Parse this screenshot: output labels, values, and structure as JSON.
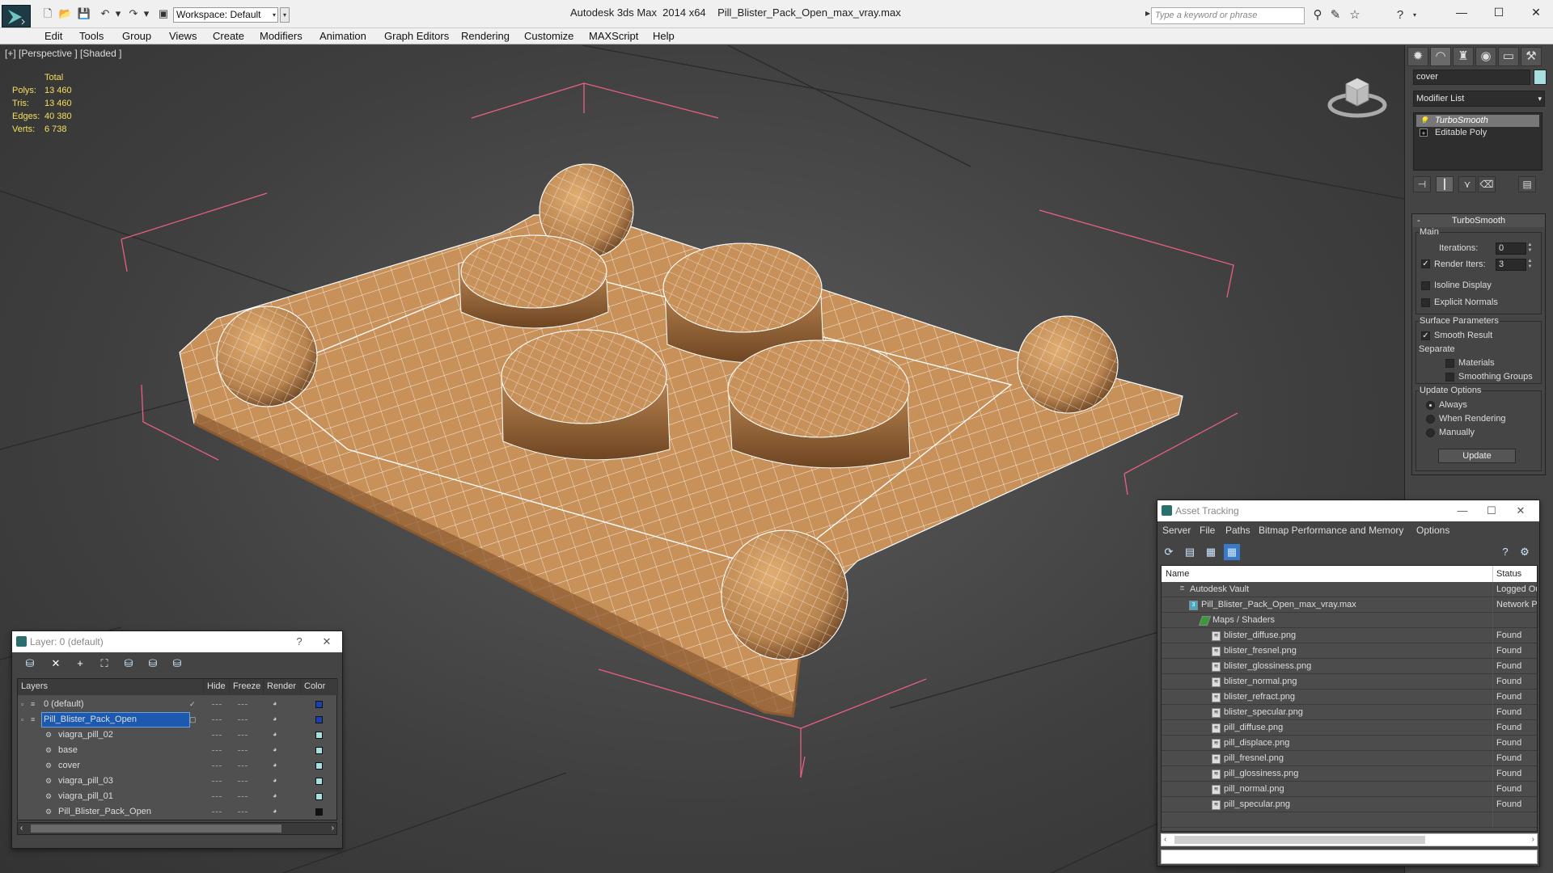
{
  "app": {
    "title": "Autodesk 3ds Max  2014 x64    Pill_Blister_Pack_Open_max_vray.max",
    "workspace": "Workspace: Default",
    "search_placeholder": "Type a keyword or phrase",
    "minimize": "—",
    "maximize": "☐",
    "close": "✕"
  },
  "menu": [
    "Edit",
    "Tools",
    "Group",
    "Views",
    "Create",
    "Modifiers",
    "Animation",
    "Graph Editors",
    "Rendering",
    "Customize",
    "MAXScript",
    "Help"
  ],
  "viewport": {
    "label": "[+] [Perspective ] [Shaded ]",
    "stats": {
      "header": "Total",
      "rows": [
        {
          "label": "Polys:",
          "value": "13 460"
        },
        {
          "label": "Tris:",
          "value": "13 460"
        },
        {
          "label": "Edges:",
          "value": "40 380"
        },
        {
          "label": "Verts:",
          "value": "6 738"
        }
      ]
    },
    "mesh_color": "#c8915a",
    "wire_color": "#ffffff"
  },
  "command_panel": {
    "object_name": "cover",
    "object_color": "#a8e0e0",
    "modifier_list": "Modifier List",
    "stack": [
      {
        "label": "TurboSmooth",
        "selected": true
      },
      {
        "label": "Editable Poly",
        "selected": false
      }
    ],
    "rollout": {
      "title": "TurboSmooth",
      "main_label": "Main",
      "iterations_label": "Iterations:",
      "iterations": "0",
      "render_iters_label": "Render Iters:",
      "render_iters": "3",
      "isoline_label": "Isoline Display",
      "explicit_label": "Explicit Normals",
      "surface_label": "Surface Parameters",
      "smooth_result_label": "Smooth Result",
      "separate_label": "Separate",
      "materials_label": "Materials",
      "smoothing_groups_label": "Smoothing Groups",
      "update_options_label": "Update Options",
      "always_label": "Always",
      "when_rendering_label": "When Rendering",
      "manually_label": "Manually",
      "update_button": "Update"
    }
  },
  "layer_window": {
    "title": "Layer: 0 (default)",
    "help": "?",
    "close": "✕",
    "columns": [
      "Layers",
      "Hide",
      "Freeze",
      "Render",
      "Color"
    ],
    "rows": [
      {
        "name": "0 (default)",
        "indent": 0,
        "color": "#1a3fb0",
        "active": true,
        "selected": false
      },
      {
        "name": "Pill_Blister_Pack_Open",
        "indent": 0,
        "color": "#1a3fb0",
        "active": false,
        "selected": true
      },
      {
        "name": "viagra_pill_02",
        "indent": 1,
        "color": "#a8e0e0",
        "active": false,
        "selected": false
      },
      {
        "name": "base",
        "indent": 1,
        "color": "#a8e0e0",
        "active": false,
        "selected": false
      },
      {
        "name": "cover",
        "indent": 1,
        "color": "#a8e0e0",
        "active": false,
        "selected": false
      },
      {
        "name": "viagra_pill_03",
        "indent": 1,
        "color": "#a8e0e0",
        "active": false,
        "selected": false
      },
      {
        "name": "viagra_pill_01",
        "indent": 1,
        "color": "#a8e0e0",
        "active": false,
        "selected": false
      },
      {
        "name": "Pill_Blister_Pack_Open",
        "indent": 1,
        "color": "#111111",
        "active": false,
        "selected": false
      }
    ]
  },
  "asset_window": {
    "title": "Asset Tracking",
    "minimize": "—",
    "maximize": "☐",
    "close": "✕",
    "menu": [
      "Server",
      "File",
      "Paths",
      "Bitmap Performance and Memory",
      "Options"
    ],
    "columns": [
      "Name",
      "Status"
    ],
    "rows": [
      {
        "name": "Autodesk Vault",
        "indent": 0,
        "status": "Logged Out"
      },
      {
        "name": "Pill_Blister_Pack_Open_max_vray.max",
        "indent": 1,
        "status": "Network Path"
      },
      {
        "name": "Maps / Shaders",
        "indent": 2,
        "status": ""
      },
      {
        "name": "blister_diffuse.png",
        "indent": 3,
        "status": "Found"
      },
      {
        "name": "blister_fresnel.png",
        "indent": 3,
        "status": "Found"
      },
      {
        "name": "blister_glossiness.png",
        "indent": 3,
        "status": "Found"
      },
      {
        "name": "blister_normal.png",
        "indent": 3,
        "status": "Found"
      },
      {
        "name": "blister_refract.png",
        "indent": 3,
        "status": "Found"
      },
      {
        "name": "blister_specular.png",
        "indent": 3,
        "status": "Found"
      },
      {
        "name": "pill_diffuse.png",
        "indent": 3,
        "status": "Found"
      },
      {
        "name": "pill_displace.png",
        "indent": 3,
        "status": "Found"
      },
      {
        "name": "pill_fresnel.png",
        "indent": 3,
        "status": "Found"
      },
      {
        "name": "pill_glossiness.png",
        "indent": 3,
        "status": "Found"
      },
      {
        "name": "pill_normal.png",
        "indent": 3,
        "status": "Found"
      },
      {
        "name": "pill_specular.png",
        "indent": 3,
        "status": "Found"
      }
    ]
  }
}
